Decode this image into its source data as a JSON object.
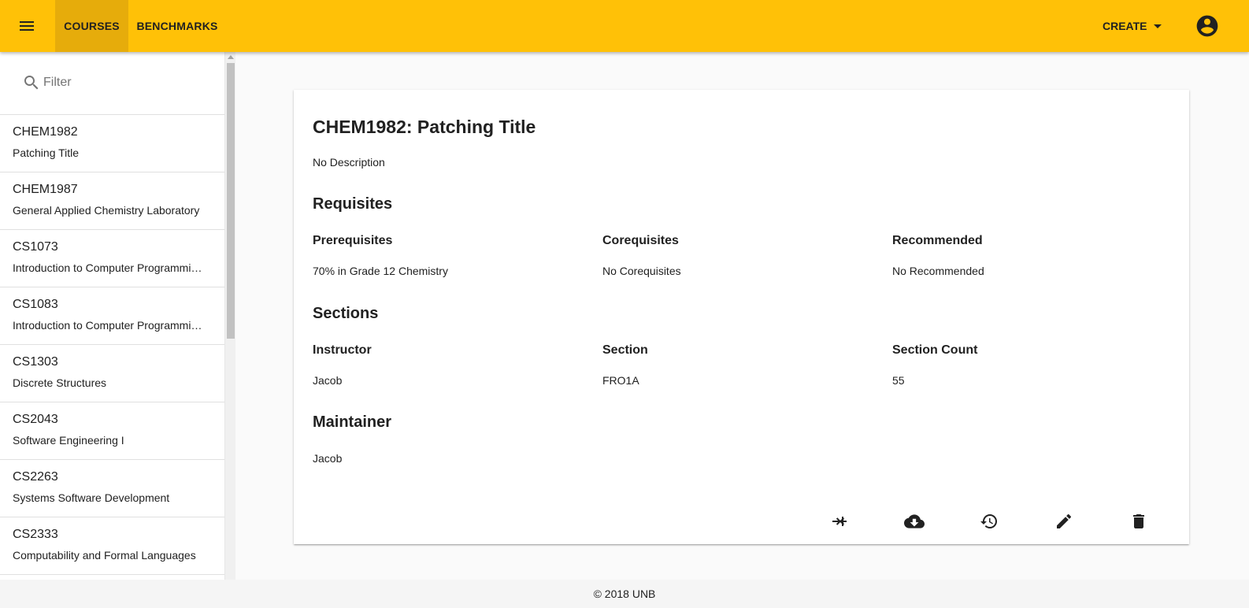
{
  "appbar": {
    "tabs": [
      {
        "label": "COURSES",
        "active": true
      },
      {
        "label": "BENCHMARKS",
        "active": false
      }
    ],
    "create_label": "CREATE",
    "accent_color": "#FFC107"
  },
  "sidebar": {
    "filter_placeholder": "Filter",
    "courses": [
      {
        "code": "CHEM1982",
        "name": "Patching Title"
      },
      {
        "code": "CHEM1987",
        "name": "General Applied Chemistry Laboratory"
      },
      {
        "code": "CS1073",
        "name": "Introduction to Computer Programming I"
      },
      {
        "code": "CS1083",
        "name": "Introduction to Computer Programming II"
      },
      {
        "code": "CS1303",
        "name": "Discrete Structures"
      },
      {
        "code": "CS2043",
        "name": "Software Engineering I"
      },
      {
        "code": "CS2263",
        "name": "Systems Software Development"
      },
      {
        "code": "CS2333",
        "name": "Computability and Formal Languages"
      }
    ]
  },
  "course": {
    "title": "CHEM1982: Patching Title",
    "description": "No Description",
    "requisites": {
      "heading": "Requisites",
      "prereq_label": "Prerequisites",
      "prereq_value": "70% in Grade 12 Chemistry",
      "coreq_label": "Corequisites",
      "coreq_value": "No Corequisites",
      "recommended_label": "Recommended",
      "recommended_value": "No Recommended"
    },
    "sections": {
      "heading": "Sections",
      "instructor_label": "Instructor",
      "instructor_value": "Jacob",
      "section_label": "Section",
      "section_value": "FRO1A",
      "count_label": "Section Count",
      "count_value": "55"
    },
    "maintainer": {
      "heading": "Maintainer",
      "value": "Jacob"
    }
  },
  "actions": [
    "compare-icon",
    "cloud-download-icon",
    "history-icon",
    "edit-icon",
    "delete-icon"
  ],
  "footer": {
    "text": "© 2018 UNB"
  }
}
